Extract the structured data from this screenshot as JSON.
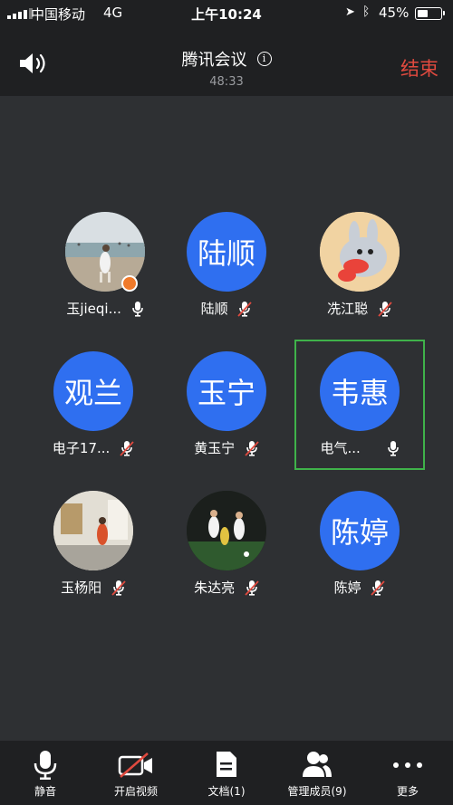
{
  "status_bar": {
    "carrier": "中国移动",
    "network": "4G",
    "time": "上午10:24",
    "battery": "45%"
  },
  "header": {
    "title": "腾讯会议",
    "duration": "48:33",
    "end_label": "结束",
    "info_glyph": "i"
  },
  "participants": [
    {
      "name": "玉jieqi...",
      "avatar_text": "",
      "mic": "on",
      "photo": "beach"
    },
    {
      "name": "陆顺",
      "avatar_text": "陆顺",
      "mic": "muted"
    },
    {
      "name": "冼江聪",
      "avatar_text": "",
      "mic": "muted",
      "photo": "cartoon"
    },
    {
      "name": "电子17...",
      "avatar_text": "观兰",
      "mic": "muted"
    },
    {
      "name": "黄玉宁",
      "avatar_text": "玉宁",
      "mic": "muted"
    },
    {
      "name": "电气...",
      "avatar_text": "韦惠",
      "mic": "on",
      "active": true
    },
    {
      "name": "玉杨阳",
      "avatar_text": "",
      "mic": "muted",
      "photo": "room"
    },
    {
      "name": "朱达亮",
      "avatar_text": "",
      "mic": "muted",
      "photo": "soccer"
    },
    {
      "name": "陈婷",
      "avatar_text": "陈婷",
      "mic": "muted"
    }
  ],
  "toolbar": {
    "mute": "静音",
    "video": "开启视频",
    "docs": "文档(1)",
    "members": "管理成员(9)",
    "more": "更多"
  },
  "colors": {
    "background": "#2e3033",
    "bar": "#1f2022",
    "avatar_blue": "#2f6ff0",
    "end_red": "#e04a3f",
    "active_border": "#3fb24a",
    "muted_red": "#e04a3f"
  }
}
